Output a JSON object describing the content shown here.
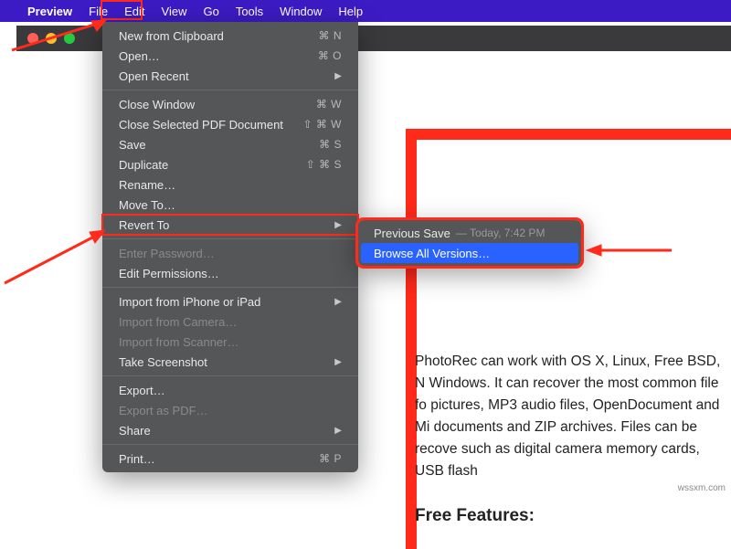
{
  "menubar": {
    "appname": "Preview",
    "items": [
      "File",
      "Edit",
      "View",
      "Go",
      "Tools",
      "Window",
      "Help"
    ]
  },
  "menu": {
    "new_from_clipboard": "New from Clipboard",
    "open": "Open…",
    "open_recent": "Open Recent",
    "close_window": "Close Window",
    "close_selected": "Close Selected PDF Document",
    "save": "Save",
    "duplicate": "Duplicate",
    "rename": "Rename…",
    "move_to": "Move To…",
    "revert_to": "Revert To",
    "enter_password": "Enter Password…",
    "edit_permissions": "Edit Permissions…",
    "import_iphone": "Import from iPhone or iPad",
    "import_camera": "Import from Camera…",
    "import_scanner": "Import from Scanner…",
    "take_screenshot": "Take Screenshot",
    "export": "Export…",
    "export_pdf": "Export as PDF…",
    "share": "Share",
    "print": "Print…",
    "sc_new": "⌘ N",
    "sc_open": "⌘ O",
    "sc_close": "⌘ W",
    "sc_close_sel": "⇧ ⌘ W",
    "sc_save": "⌘ S",
    "sc_dup": "⇧ ⌘ S",
    "sc_print": "⌘ P"
  },
  "submenu": {
    "previous_save": "Previous Save",
    "timestamp": "— Today, 7:42 PM",
    "browse_all": "Browse All Versions…"
  },
  "doc": {
    "para": "PhotoRec can work with OS X, Linux, Free BSD, N Windows. It can recover the most common file fo pictures, MP3 audio files, OpenDocument and Mi documents and ZIP archives. Files can be recove such as digital camera memory cards, USB flash",
    "heading": "Free Features:"
  },
  "watermark": "wssxm.com"
}
